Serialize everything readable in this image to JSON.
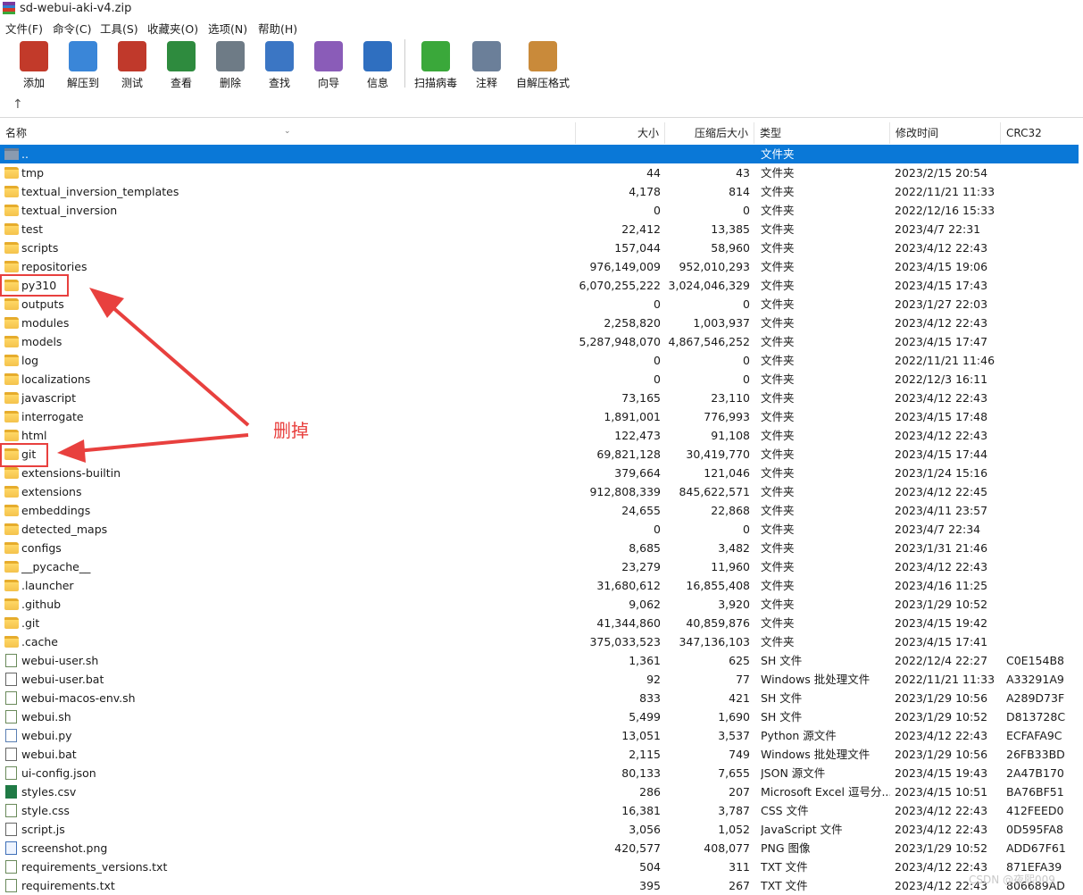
{
  "window": {
    "title": "sd-webui-aki-v4.zip"
  },
  "menu": [
    "文件(F)",
    "命令(C)",
    "工具(S)",
    "收藏夹(O)",
    "选项(N)",
    "帮助(H)"
  ],
  "toolbar": [
    {
      "label": "添加",
      "icon": "add-archive-icon",
      "color": "#c23a2a"
    },
    {
      "label": "解压到",
      "icon": "extract-folder-icon",
      "color": "#3a86d8"
    },
    {
      "label": "测试",
      "icon": "test-checklist-icon",
      "color": "#c0392b"
    },
    {
      "label": "查看",
      "icon": "view-book-icon",
      "color": "#2e8b3e"
    },
    {
      "label": "删除",
      "icon": "delete-trash-icon",
      "color": "#6e7b86"
    },
    {
      "label": "查找",
      "icon": "find-magnifier-icon",
      "color": "#3b76c4"
    },
    {
      "label": "向导",
      "icon": "wizard-wand-icon",
      "color": "#8a5cb8"
    },
    {
      "label": "信息",
      "icon": "info-icon",
      "color": "#2f6fc0"
    },
    {
      "label": "扫描病毒",
      "icon": "virus-scan-icon",
      "color": "#3aa83a"
    },
    {
      "label": "注释",
      "icon": "comment-icon",
      "color": "#6b7f99"
    },
    {
      "label": "自解压格式",
      "icon": "sfx-box-icon",
      "color": "#c98a3a"
    }
  ],
  "columns": {
    "name": "名称",
    "size": "大小",
    "packed": "压缩后大小",
    "type": "类型",
    "modified": "修改时间",
    "crc": "CRC32"
  },
  "rows": [
    {
      "name": "..",
      "size": "",
      "packed": "",
      "type": "文件夹",
      "modified": "",
      "crc": "",
      "kind": "updir",
      "selected": true
    },
    {
      "name": "tmp",
      "size": "44",
      "packed": "43",
      "type": "文件夹",
      "modified": "2023/2/15 20:54",
      "crc": "",
      "kind": "folder"
    },
    {
      "name": "textual_inversion_templates",
      "size": "4,178",
      "packed": "814",
      "type": "文件夹",
      "modified": "2022/11/21 11:33",
      "crc": "",
      "kind": "folder"
    },
    {
      "name": "textual_inversion",
      "size": "0",
      "packed": "0",
      "type": "文件夹",
      "modified": "2022/12/16 15:33",
      "crc": "",
      "kind": "folder"
    },
    {
      "name": "test",
      "size": "22,412",
      "packed": "13,385",
      "type": "文件夹",
      "modified": "2023/4/7 22:31",
      "crc": "",
      "kind": "folder"
    },
    {
      "name": "scripts",
      "size": "157,044",
      "packed": "58,960",
      "type": "文件夹",
      "modified": "2023/4/12 22:43",
      "crc": "",
      "kind": "folder"
    },
    {
      "name": "repositories",
      "size": "976,149,009",
      "packed": "952,010,293",
      "type": "文件夹",
      "modified": "2023/4/15 19:06",
      "crc": "",
      "kind": "folder"
    },
    {
      "name": "py310",
      "size": "6,070,255,222",
      "packed": "3,024,046,329",
      "type": "文件夹",
      "modified": "2023/4/15 17:43",
      "crc": "",
      "kind": "folder"
    },
    {
      "name": "outputs",
      "size": "0",
      "packed": "0",
      "type": "文件夹",
      "modified": "2023/1/27 22:03",
      "crc": "",
      "kind": "folder"
    },
    {
      "name": "modules",
      "size": "2,258,820",
      "packed": "1,003,937",
      "type": "文件夹",
      "modified": "2023/4/12 22:43",
      "crc": "",
      "kind": "folder"
    },
    {
      "name": "models",
      "size": "5,287,948,070",
      "packed": "4,867,546,252",
      "type": "文件夹",
      "modified": "2023/4/15 17:47",
      "crc": "",
      "kind": "folder"
    },
    {
      "name": "log",
      "size": "0",
      "packed": "0",
      "type": "文件夹",
      "modified": "2022/11/21 11:46",
      "crc": "",
      "kind": "folder"
    },
    {
      "name": "localizations",
      "size": "0",
      "packed": "0",
      "type": "文件夹",
      "modified": "2022/12/3 16:11",
      "crc": "",
      "kind": "folder"
    },
    {
      "name": "javascript",
      "size": "73,165",
      "packed": "23,110",
      "type": "文件夹",
      "modified": "2023/4/12 22:43",
      "crc": "",
      "kind": "folder"
    },
    {
      "name": "interrogate",
      "size": "1,891,001",
      "packed": "776,993",
      "type": "文件夹",
      "modified": "2023/4/15 17:48",
      "crc": "",
      "kind": "folder"
    },
    {
      "name": "html",
      "size": "122,473",
      "packed": "91,108",
      "type": "文件夹",
      "modified": "2023/4/12 22:43",
      "crc": "",
      "kind": "folder"
    },
    {
      "name": "git",
      "size": "69,821,128",
      "packed": "30,419,770",
      "type": "文件夹",
      "modified": "2023/4/15 17:44",
      "crc": "",
      "kind": "folder"
    },
    {
      "name": "extensions-builtin",
      "size": "379,664",
      "packed": "121,046",
      "type": "文件夹",
      "modified": "2023/1/24 15:16",
      "crc": "",
      "kind": "folder"
    },
    {
      "name": "extensions",
      "size": "912,808,339",
      "packed": "845,622,571",
      "type": "文件夹",
      "modified": "2023/4/12 22:45",
      "crc": "",
      "kind": "folder"
    },
    {
      "name": "embeddings",
      "size": "24,655",
      "packed": "22,868",
      "type": "文件夹",
      "modified": "2023/4/11 23:57",
      "crc": "",
      "kind": "folder"
    },
    {
      "name": "detected_maps",
      "size": "0",
      "packed": "0",
      "type": "文件夹",
      "modified": "2023/4/7 22:34",
      "crc": "",
      "kind": "folder"
    },
    {
      "name": "configs",
      "size": "8,685",
      "packed": "3,482",
      "type": "文件夹",
      "modified": "2023/1/31 21:46",
      "crc": "",
      "kind": "folder"
    },
    {
      "name": "__pycache__",
      "size": "23,279",
      "packed": "11,960",
      "type": "文件夹",
      "modified": "2023/4/12 22:43",
      "crc": "",
      "kind": "folder"
    },
    {
      "name": ".launcher",
      "size": "31,680,612",
      "packed": "16,855,408",
      "type": "文件夹",
      "modified": "2023/4/16 11:25",
      "crc": "",
      "kind": "folder"
    },
    {
      "name": ".github",
      "size": "9,062",
      "packed": "3,920",
      "type": "文件夹",
      "modified": "2023/1/29 10:52",
      "crc": "",
      "kind": "folder"
    },
    {
      "name": ".git",
      "size": "41,344,860",
      "packed": "40,859,876",
      "type": "文件夹",
      "modified": "2023/4/15 19:42",
      "crc": "",
      "kind": "folder"
    },
    {
      "name": ".cache",
      "size": "375,033,523",
      "packed": "347,136,103",
      "type": "文件夹",
      "modified": "2023/4/15 17:41",
      "crc": "",
      "kind": "folder"
    },
    {
      "name": "webui-user.sh",
      "size": "1,361",
      "packed": "625",
      "type": "SH 文件",
      "modified": "2022/12/4 22:27",
      "crc": "C0E154B8",
      "kind": "file"
    },
    {
      "name": "webui-user.bat",
      "size": "92",
      "packed": "77",
      "type": "Windows 批处理文件",
      "modified": "2022/11/21 11:33",
      "crc": "A33291A9",
      "kind": "bat"
    },
    {
      "name": "webui-macos-env.sh",
      "size": "833",
      "packed": "421",
      "type": "SH 文件",
      "modified": "2023/1/29 10:56",
      "crc": "A289D73F",
      "kind": "file"
    },
    {
      "name": "webui.sh",
      "size": "5,499",
      "packed": "1,690",
      "type": "SH 文件",
      "modified": "2023/1/29 10:52",
      "crc": "D813728C",
      "kind": "file"
    },
    {
      "name": "webui.py",
      "size": "13,051",
      "packed": "3,537",
      "type": "Python 源文件",
      "modified": "2023/4/12 22:43",
      "crc": "ECFAFA9C",
      "kind": "py"
    },
    {
      "name": "webui.bat",
      "size": "2,115",
      "packed": "749",
      "type": "Windows 批处理文件",
      "modified": "2023/1/29 10:56",
      "crc": "26FB33BD",
      "kind": "bat"
    },
    {
      "name": "ui-config.json",
      "size": "80,133",
      "packed": "7,655",
      "type": "JSON 源文件",
      "modified": "2023/4/15 19:43",
      "crc": "2A47B170",
      "kind": "file"
    },
    {
      "name": "styles.csv",
      "size": "286",
      "packed": "207",
      "type": "Microsoft Excel 逗号分...",
      "modified": "2023/4/15 10:51",
      "crc": "BA76BF51",
      "kind": "xls"
    },
    {
      "name": "style.css",
      "size": "16,381",
      "packed": "3,787",
      "type": "CSS 文件",
      "modified": "2023/4/12 22:43",
      "crc": "412FEED0",
      "kind": "file"
    },
    {
      "name": "script.js",
      "size": "3,056",
      "packed": "1,052",
      "type": "JavaScript 文件",
      "modified": "2023/4/12 22:43",
      "crc": "0D595FA8",
      "kind": "bat"
    },
    {
      "name": "screenshot.png",
      "size": "420,577",
      "packed": "408,077",
      "type": "PNG 图像",
      "modified": "2023/1/29 10:52",
      "crc": "ADD67F61",
      "kind": "png"
    },
    {
      "name": "requirements_versions.txt",
      "size": "504",
      "packed": "311",
      "type": "TXT 文件",
      "modified": "2023/4/12 22:43",
      "crc": "871EFA39",
      "kind": "file"
    },
    {
      "name": "requirements.txt",
      "size": "395",
      "packed": "267",
      "type": "TXT 文件",
      "modified": "2023/4/12 22:43",
      "crc": "806689AD",
      "kind": "file"
    }
  ],
  "annotation": {
    "text": "删掉",
    "color": "#e8403e"
  },
  "watermark": "CSDN @夜熙009"
}
